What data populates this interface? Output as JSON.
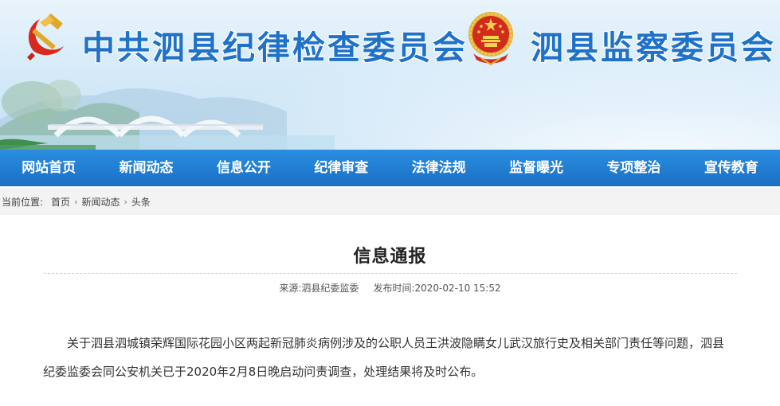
{
  "header": {
    "title_left": "中共泗县纪律检查委员会",
    "title_right": "泗县监察委员会",
    "emblem_left_icon": "party-emblem-icon",
    "emblem_right_icon": "national-emblem-icon",
    "title_color": "#1f72c8"
  },
  "nav": {
    "items": [
      {
        "label": "网站首页"
      },
      {
        "label": "新闻动态"
      },
      {
        "label": "信息公开"
      },
      {
        "label": "纪律审查"
      },
      {
        "label": "法律法规"
      },
      {
        "label": "监督曝光"
      },
      {
        "label": "专项整治"
      },
      {
        "label": "宣传教育"
      }
    ],
    "background": "#1f7fd6"
  },
  "breadcrumb": {
    "prefix": "当前位置:",
    "items": [
      "首页",
      "新闻动态",
      "头条"
    ],
    "separator": "›"
  },
  "article": {
    "title": "信息通报",
    "source_label": "来源:",
    "source": "泗县纪委监委",
    "date_label": "发布时间:",
    "date": "2020-02-10 15:52",
    "body": "关于泗县泗城镇荣辉国际花园小区两起新冠肺炎病例涉及的公职人员王洪波隐瞒女儿武汉旅行史及相关部门责任等问题，泗县纪委监委会同公安机关已于2020年2月8日晚启动问责调查，处理结果将及时公布。"
  }
}
